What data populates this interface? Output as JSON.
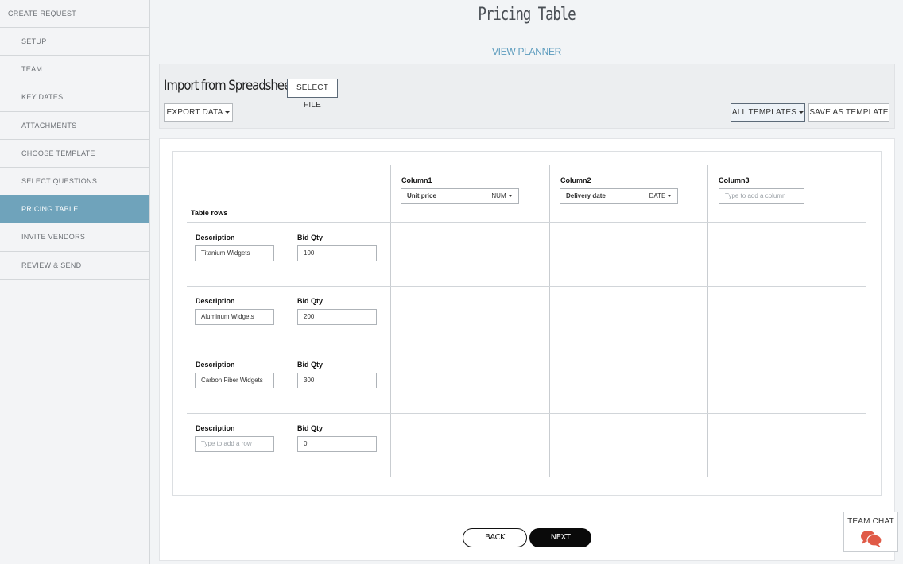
{
  "sidebar": {
    "header": "CREATE REQUEST",
    "items": [
      {
        "label": "SETUP"
      },
      {
        "label": "TEAM"
      },
      {
        "label": "KEY DATES"
      },
      {
        "label": "ATTACHMENTS"
      },
      {
        "label": "CHOOSE TEMPLATE"
      },
      {
        "label": "SELECT QUESTIONS"
      },
      {
        "label": "PRICING TABLE",
        "active": true
      },
      {
        "label": "INVITE VENDORS"
      },
      {
        "label": "REVIEW & SEND"
      }
    ]
  },
  "page": {
    "title": "Pricing Table",
    "view_planner": "VIEW PLANNER"
  },
  "toolbar": {
    "import_label": "Import from Spreadsheet:",
    "select_file": "SELECT FILE",
    "export_data": "EXPORT DATA",
    "all_templates": "ALL TEMPLATES",
    "save_as_template": "SAVE AS TEMPLATE"
  },
  "table": {
    "rows_header": "Table rows",
    "columns": [
      {
        "header": "Column1",
        "value": "Unit price",
        "type": "NUM"
      },
      {
        "header": "Column2",
        "value": "Delivery date",
        "type": "DATE"
      },
      {
        "header": "Column3",
        "placeholder": "Type to add a column"
      }
    ],
    "description_label": "Description",
    "qty_label": "Bid Qty",
    "rows": [
      {
        "description": "Titanium Widgets",
        "qty": "100"
      },
      {
        "description": "Aluminum Widgets",
        "qty": "200"
      },
      {
        "description": "Carbon Fiber Widgets",
        "qty": "300"
      },
      {
        "description_placeholder": "Type to add a row",
        "qty": "0"
      }
    ]
  },
  "footer": {
    "back": "BACK",
    "next": "NEXT"
  },
  "team_chat": {
    "label": "TEAM CHAT",
    "icon": "chat-bubbles-icon",
    "icon_color": "#e05a47"
  },
  "colors": {
    "accent": "#6fa3bb",
    "link": "#5b9bbd"
  }
}
